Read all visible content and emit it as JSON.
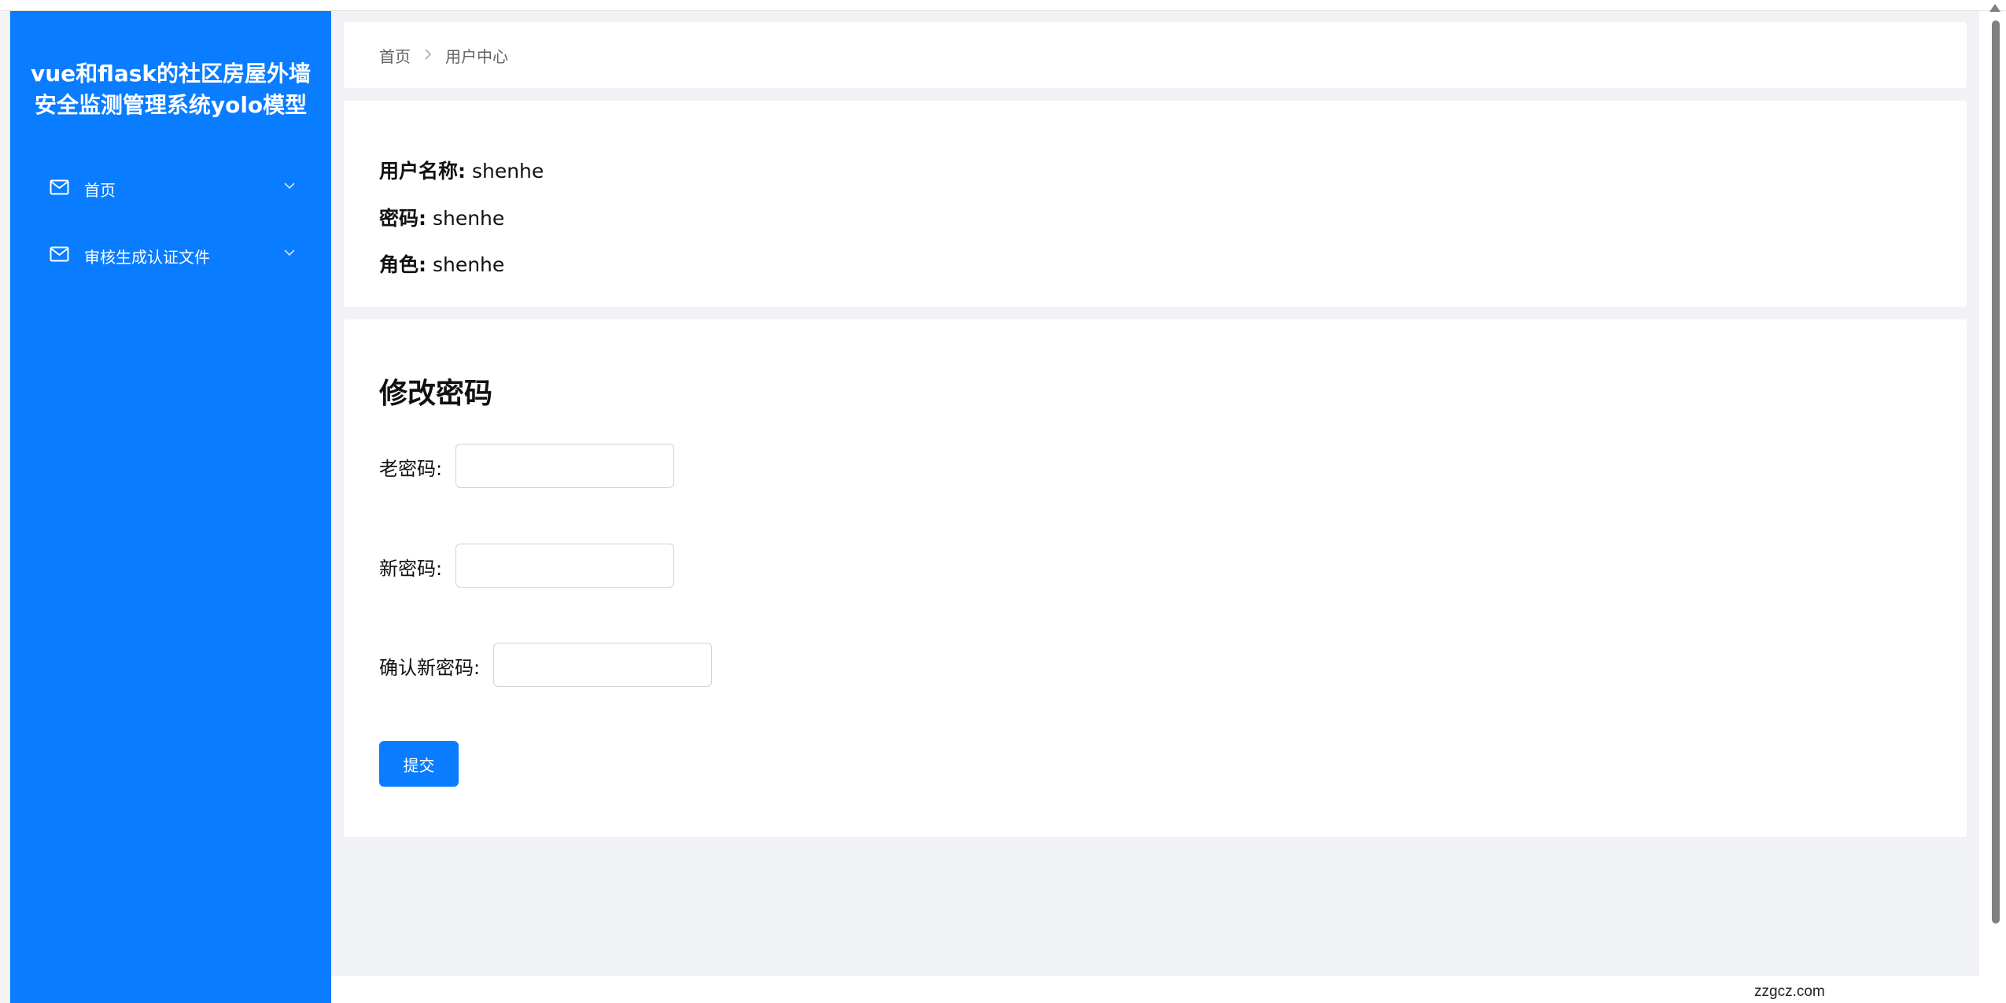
{
  "sidebar": {
    "title": "vue和flask的社区房屋外墙安全监测管理系统yolo模型",
    "items": [
      {
        "label": "首页",
        "icon": "mail-icon"
      },
      {
        "label": "审核生成认证文件",
        "icon": "mail-icon"
      }
    ]
  },
  "breadcrumb": {
    "home": "首页",
    "current": "用户中心"
  },
  "user_info": {
    "username_label": "用户名称:",
    "username_value": "shenhe",
    "password_label": "密码:",
    "password_value": "shenhe",
    "role_label": "角色:",
    "role_value": "shenhe"
  },
  "change_password": {
    "title": "修改密码",
    "old_label": "老密码:",
    "old_value": "",
    "new_label": "新密码:",
    "new_value": "",
    "confirm_label": "确认新密码:",
    "confirm_value": "",
    "submit_label": "提交"
  },
  "watermark": "zzgcz.com",
  "colors": {
    "sidebar_bg": "#0a7cff",
    "primary": "#0a7cff",
    "page_bg": "#f0f2f5"
  }
}
